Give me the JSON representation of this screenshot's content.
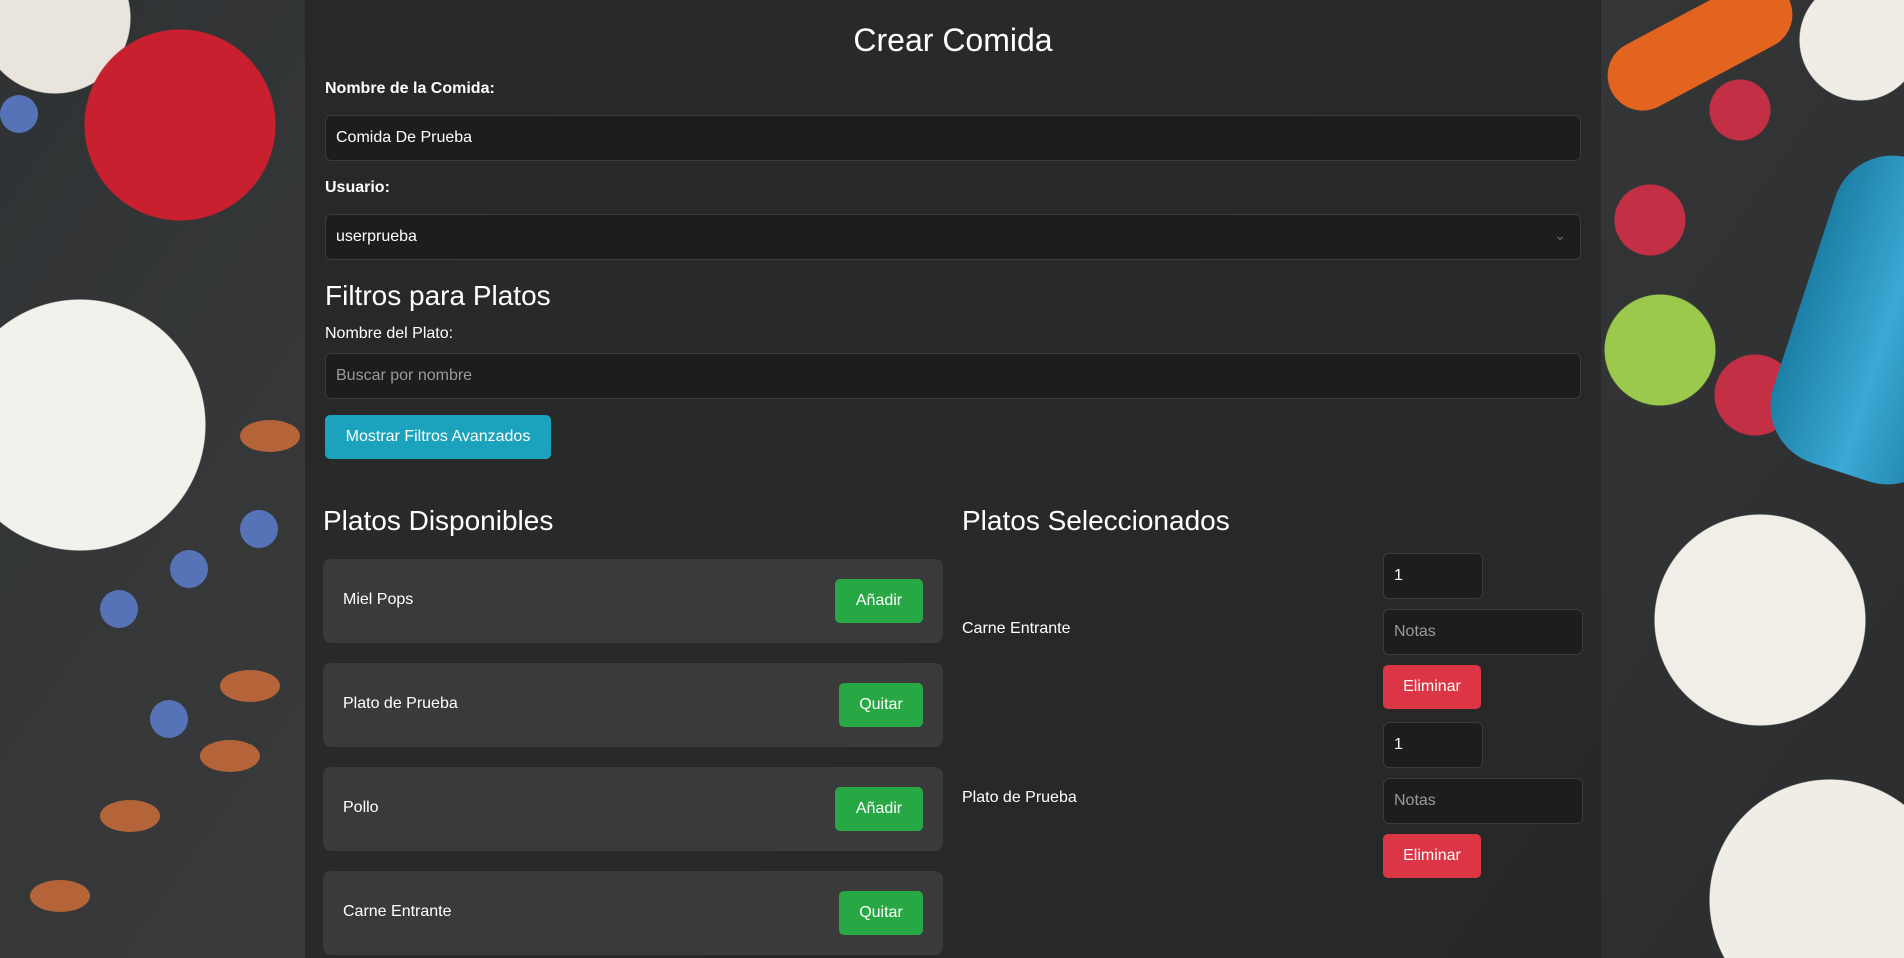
{
  "form": {
    "title": "Crear Comida",
    "meal_name_label": "Nombre de la Comida:",
    "meal_name_value": "Comida De Prueba",
    "user_label": "Usuario:",
    "user_value": "userprueba"
  },
  "filters": {
    "heading": "Filtros para Platos",
    "dish_name_label": "Nombre del Plato:",
    "dish_name_placeholder": "Buscar por nombre",
    "advanced_button": "Mostrar Filtros Avanzados"
  },
  "available": {
    "heading": "Platos Disponibles",
    "items": [
      {
        "name": "Miel Pops",
        "action": "Añadir"
      },
      {
        "name": "Plato de Prueba",
        "action": "Quitar"
      },
      {
        "name": "Pollo",
        "action": "Añadir"
      },
      {
        "name": "Carne Entrante",
        "action": "Quitar"
      }
    ]
  },
  "selected": {
    "heading": "Platos Seleccionados",
    "items": [
      {
        "name": "Carne Entrante",
        "quantity": "1",
        "notes_placeholder": "Notas",
        "remove": "Eliminar"
      },
      {
        "name": "Plato de Prueba",
        "quantity": "1",
        "notes_placeholder": "Notas",
        "remove": "Eliminar"
      }
    ]
  },
  "colors": {
    "primary_teal": "#1ba3bd",
    "success_green": "#28a745",
    "danger_red": "#dc3545"
  }
}
